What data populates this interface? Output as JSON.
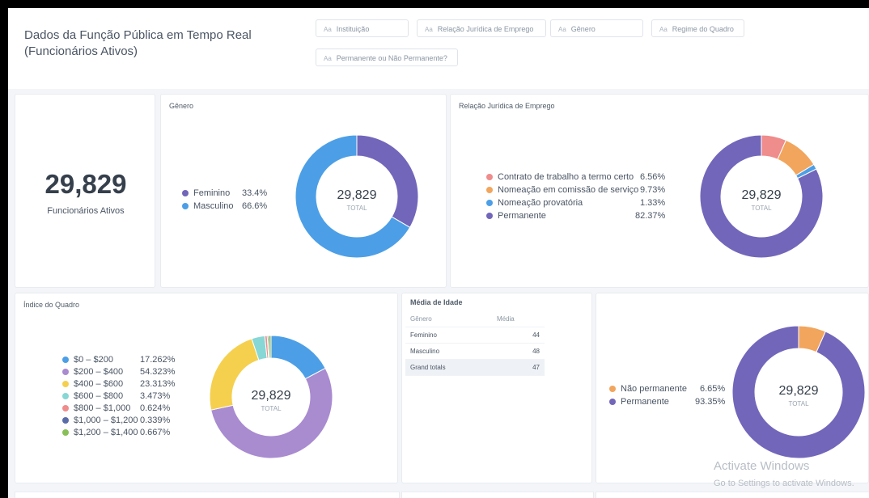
{
  "dashboard": {
    "title": "Dados da Função Pública em Tempo Real (Funcionários Ativos)",
    "filters": [
      "Instituição",
      "Relação Jurídica de Emprego",
      "Gênero",
      "Regime do Quadro",
      "Permanente ou Não Permanente?"
    ],
    "filter_icon": "Aa"
  },
  "kpi": {
    "value": "29,829",
    "label": "Funcionários Ativos"
  },
  "genero": {
    "title": "Gênero",
    "center_value": "29,829",
    "center_label": "TOTAL",
    "legend": [
      {
        "label": "Feminino",
        "pct": "33.4%",
        "color": "#7266ba"
      },
      {
        "label": "Masculino",
        "pct": "66.6%",
        "color": "#4c9fe6"
      }
    ]
  },
  "relacao": {
    "title": "Relação Jurídica de Emprego",
    "center_value": "29,829",
    "center_label": "TOTAL",
    "legend": [
      {
        "label": "Contrato de trabalho a termo certo",
        "pct": "6.56%",
        "color": "#ef8c8c"
      },
      {
        "label": "Nomeação em comissão de serviço",
        "pct": "9.73%",
        "color": "#f2a55d"
      },
      {
        "label": "Nomeação provatória",
        "pct": "1.33%",
        "color": "#4c9fe6"
      },
      {
        "label": "Permanente",
        "pct": "82.37%",
        "color": "#7266ba"
      }
    ]
  },
  "indice": {
    "title": "Índice do Quadro",
    "center_value": "29,829",
    "center_label": "TOTAL",
    "legend": [
      {
        "label": "$0 – $200",
        "pct": "17.262%",
        "color": "#4c9fe6"
      },
      {
        "label": "$200 – $400",
        "pct": "54.323%",
        "color": "#a98bd0"
      },
      {
        "label": "$400 – $600",
        "pct": "23.313%",
        "color": "#f5d04f"
      },
      {
        "label": "$600 – $800",
        "pct": "3.473%",
        "color": "#86d7d5"
      },
      {
        "label": "$800 – $1,000",
        "pct": "0.624%",
        "color": "#ef8c8c"
      },
      {
        "label": "$1,000 – $1,200",
        "pct": "0.339%",
        "color": "#5a6ca8"
      },
      {
        "label": "$1,200 – $1,400",
        "pct": "0.667%",
        "color": "#88c057"
      }
    ]
  },
  "media": {
    "title": "Média de Idade",
    "columns": [
      "Gênero",
      "Média"
    ],
    "rows": [
      {
        "label": "Feminino",
        "value": "44"
      },
      {
        "label": "Masculino",
        "value": "48"
      },
      {
        "label": "Grand totals",
        "value": "47"
      }
    ]
  },
  "permanente": {
    "center_value": "29,829",
    "center_label": "TOTAL",
    "legend": [
      {
        "label": "Não permanente",
        "pct": "6.65%",
        "color": "#f2a55d"
      },
      {
        "label": "Permanente",
        "pct": "93.35%",
        "color": "#7266ba"
      }
    ]
  },
  "watermark": {
    "line1": "Activate Windows",
    "line2": "Go to Settings to activate Windows."
  },
  "chart_data": [
    {
      "type": "pie",
      "title": "Gênero",
      "categories": [
        "Feminino",
        "Masculino"
      ],
      "values": [
        33.4,
        66.6
      ]
    },
    {
      "type": "pie",
      "title": "Relação Jurídica de Emprego",
      "categories": [
        "Contrato de trabalho a termo certo",
        "Nomeação em comissão de serviço",
        "Nomeação provatória",
        "Permanente"
      ],
      "values": [
        6.56,
        9.73,
        1.33,
        82.37
      ]
    },
    {
      "type": "pie",
      "title": "Índice do Quadro",
      "categories": [
        "$0 – $200",
        "$200 – $400",
        "$400 – $600",
        "$600 – $800",
        "$800 – $1,000",
        "$1,000 – $1,200",
        "$1,200 – $1,400"
      ],
      "values": [
        17.262,
        54.323,
        23.313,
        3.473,
        0.624,
        0.339,
        0.667
      ]
    },
    {
      "type": "pie",
      "title": "",
      "categories": [
        "Não permanente",
        "Permanente"
      ],
      "values": [
        6.65,
        93.35
      ]
    }
  ]
}
